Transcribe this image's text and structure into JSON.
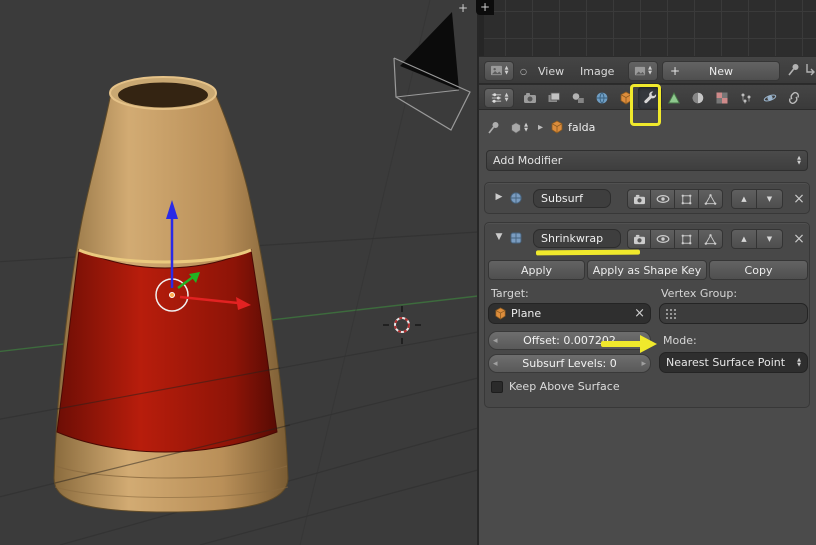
{
  "colors": {
    "annotation_yellow": "#f0e92c",
    "viewport_bg": "#3b3b3b",
    "panel_bg": "#4b4b4b",
    "object_tan": "#c49a62",
    "object_red": "#a51408",
    "axis_x_red": "#e22222",
    "axis_y_green": "#22b422",
    "axis_z_blue": "#2a2ae6"
  },
  "glyphs": {
    "plus": "+",
    "close": "×",
    "up": "▲",
    "down": "▼",
    "right": "▶",
    "left_small": "◂",
    "right_small": "▸",
    "circle": "○"
  },
  "image_editor": {
    "menus": {
      "view": "View",
      "image": "Image"
    },
    "new_button": "New"
  },
  "properties_tabs": [
    "render",
    "render-layers",
    "scene",
    "world",
    "object",
    "modifiers",
    "object-data",
    "material",
    "texture",
    "particles",
    "physics",
    "constraints"
  ],
  "active_tab": "modifiers",
  "breadcrumb": {
    "object": "falda"
  },
  "add_modifier": "Add Modifier",
  "modifier_subsurf": {
    "name": "Subsurf"
  },
  "modifier_shrinkwrap": {
    "name": "Shrinkwrap",
    "apply": "Apply",
    "apply_as_shape_key": "Apply as Shape Key",
    "copy": "Copy",
    "target_label": "Target:",
    "vertex_group_label": "Vertex Group:",
    "target": "Plane",
    "offset": "Offset: 0.007202",
    "subsurf_levels": "Subsurf Levels: 0",
    "mode_label": "Mode:",
    "mode": "Nearest Surface Point",
    "keep_above_surface": "Keep Above Surface"
  }
}
